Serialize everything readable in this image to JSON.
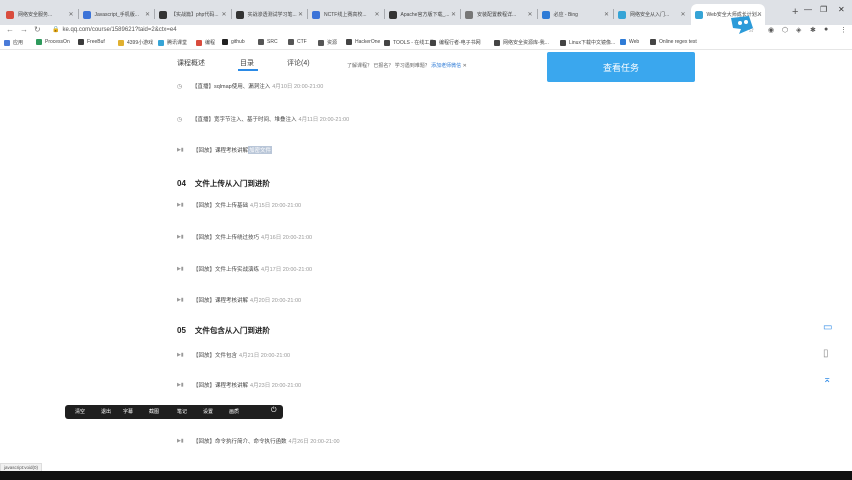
{
  "browser": {
    "tabs": [
      {
        "title": "网络安全服务...",
        "color": "#d94c3d"
      },
      {
        "title": "Javascript_手机版...",
        "color": "#3b73d8"
      },
      {
        "title": "【实战篇】php代码...",
        "color": "#333333"
      },
      {
        "title": "实战渗透测试学习笔...",
        "color": "#333333"
      },
      {
        "title": "NCTF线上赛高校...",
        "color": "#3b73d8"
      },
      {
        "title": "Apache官方版下载_...",
        "color": "#333333"
      },
      {
        "title": "安装配置教程详...",
        "color": "#777777"
      },
      {
        "title": "必应 - Bing",
        "color": "#2e7bd6"
      },
      {
        "title": "网络安全从入门...",
        "color": "#36a4d6"
      },
      {
        "title": "Web安全大师成长计划...",
        "color": "#36a4d6"
      }
    ],
    "url": "ke.qq.com/course/1589621?taid=2&ctx=e4",
    "bookmarks": [
      {
        "label": "应用",
        "color": "#4a7bd8"
      },
      {
        "label": "ProcessOn",
        "color": "#2e9a5c"
      },
      {
        "label": "FreeBuf",
        "color": "#3b3b3b"
      },
      {
        "label": "4399小游戏",
        "color": "#e0b030"
      },
      {
        "label": "腾讯课堂",
        "color": "#36a4d6"
      },
      {
        "label": "编程",
        "color": "#d94c3d"
      },
      {
        "label": "github",
        "color": "#222222"
      },
      {
        "label": "SRC",
        "color": "#555555"
      },
      {
        "label": "CTF",
        "color": "#555555"
      },
      {
        "label": "资源",
        "color": "#555555"
      },
      {
        "label": "HackerOne",
        "color": "#444444"
      },
      {
        "label": "TOOLS - 在线工具",
        "color": "#444444"
      },
      {
        "label": "编程行者-电子书网",
        "color": "#444444"
      },
      {
        "label": "网络安全资源库-我...",
        "color": "#444444"
      },
      {
        "label": "Linux下载中文镜像...",
        "color": "#444444"
      },
      {
        "label": "Web",
        "color": "#2e7bd6"
      },
      {
        "label": "Online regex test",
        "color": "#444444"
      }
    ]
  },
  "course_tabs": {
    "overview": "课程概述",
    "catalog": "目录",
    "reviews": "评论(4)",
    "tip": "了解课程？ 已报名？ 学习遇到难题？",
    "tip_link": "添加老师微信"
  },
  "view_task_label": "查看任务",
  "rows_top": [
    {
      "icon": "clock",
      "text": "【直播】sqlmap使用、漏洞注入",
      "time": "4月10日 20:00-21:00"
    },
    {
      "icon": "clock",
      "text": "【直播】宽字节注入、基于时间、堆叠注入",
      "time": "4月11日 20:00-21:00"
    },
    {
      "icon": "play",
      "text": "【回放】课程考核讲解",
      "highlight": "加密文件",
      "time": ""
    }
  ],
  "chapter4": {
    "num": "04",
    "title": "文件上传从入门到进阶"
  },
  "rows_ch4": [
    {
      "text": "【回放】文件上传基础",
      "time": "4月15日 20:00-21:00"
    },
    {
      "text": "【回放】文件上传绕过技巧",
      "time": "4月16日 20:00-21:00"
    },
    {
      "text": "【回放】文件上传实战演练",
      "time": "4月17日 20:00-21:00"
    },
    {
      "text": "【回放】课程考核讲解",
      "time": "4月20日 20:00-21:00"
    }
  ],
  "chapter5": {
    "num": "05",
    "title": "文件包含从入门到进阶"
  },
  "rows_ch5": [
    {
      "text": "【回放】文件包含",
      "time": "4月21日 20:00-21:00"
    },
    {
      "text": "【回放】课程考核讲解",
      "time": "4月23日 20:00-21:00"
    }
  ],
  "row_exec": {
    "text": "【回放】命令执行简介、命令执行函数",
    "time": "4月26日 20:00-21:00"
  },
  "video_bar": [
    "清空",
    "退出",
    "字幕",
    "截图",
    "笔记",
    "设置",
    "画质"
  ],
  "status_url": "javascript:void(0)"
}
